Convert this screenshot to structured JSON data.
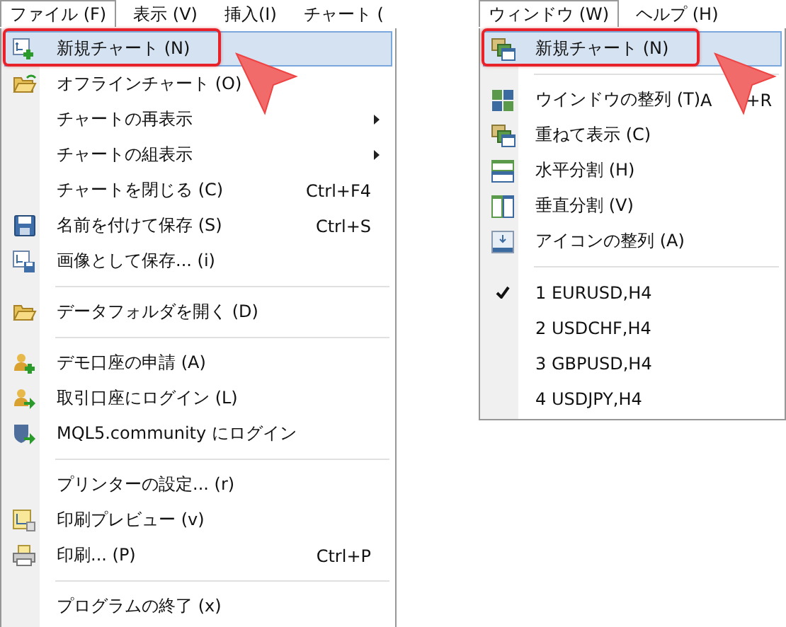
{
  "menus": [
    {
      "menubar": [
        {
          "label": "ファイル (F)",
          "selected": true
        },
        {
          "label": "表示 (V)",
          "selected": false
        },
        {
          "label": "挿入(I)",
          "selected": false
        },
        {
          "label": "チャート (",
          "selected": false
        }
      ],
      "items": [
        {
          "kind": "item",
          "label": "新規チャート (N)",
          "selected": true,
          "marked": true
        },
        {
          "kind": "item",
          "label": "オフラインチャート (O)",
          "selected": false,
          "marked": false
        },
        {
          "kind": "item",
          "label": "チャートの再表示",
          "selected": false,
          "marked": false,
          "submenu": true
        },
        {
          "kind": "item",
          "label": "チャートの組表示",
          "selected": false,
          "marked": false,
          "submenu": true
        },
        {
          "kind": "item",
          "label": "チャートを閉じる (C)",
          "shortcut": "Ctrl+F4",
          "selected": false,
          "marked": false
        },
        {
          "kind": "item",
          "label": "名前を付けて保存 (S)",
          "shortcut": "Ctrl+S",
          "selected": false,
          "marked": false
        },
        {
          "kind": "item",
          "label": "画像として保存... (i)",
          "selected": false,
          "marked": false
        },
        {
          "kind": "separator"
        },
        {
          "kind": "item",
          "label": "データフォルダを開く (D)",
          "selected": false,
          "marked": false
        },
        {
          "kind": "separator"
        },
        {
          "kind": "item",
          "label": "デモ口座の申請 (A)",
          "selected": false,
          "marked": false
        },
        {
          "kind": "item",
          "label": "取引口座にログイン (L)",
          "selected": false,
          "marked": false
        },
        {
          "kind": "item",
          "label": "MQL5.community にログイン",
          "selected": false,
          "marked": false
        },
        {
          "kind": "separator"
        },
        {
          "kind": "item",
          "label": "プリンターの設定... (r)",
          "selected": false,
          "marked": false
        },
        {
          "kind": "item",
          "label": "印刷プレビュー (v)",
          "selected": false,
          "marked": false
        },
        {
          "kind": "item",
          "label": "印刷... (P)",
          "shortcut": "Ctrl+P",
          "selected": false,
          "marked": false
        },
        {
          "kind": "separator"
        },
        {
          "kind": "item",
          "label": "プログラムの終了 (x)",
          "selected": false,
          "marked": false
        }
      ]
    },
    {
      "menubar": [
        {
          "label": "ウィンドウ (W)",
          "selected": true
        },
        {
          "label": "ヘルプ (H)",
          "selected": false
        }
      ],
      "items": [
        {
          "kind": "item",
          "label": "新規チャート (N)",
          "selected": true,
          "marked": true
        },
        {
          "kind": "separator"
        },
        {
          "kind": "item",
          "label": "ウインドウの整列 (T)",
          "shortcut": [
            "A",
            "+R"
          ],
          "selected": false,
          "marked": false
        },
        {
          "kind": "item",
          "label": "重ねて表示 (C)",
          "selected": false,
          "marked": false
        },
        {
          "kind": "item",
          "label": "水平分割 (H)",
          "selected": false,
          "marked": false
        },
        {
          "kind": "item",
          "label": "垂直分割 (V)",
          "selected": false,
          "marked": false
        },
        {
          "kind": "item",
          "label": "アイコンの整列 (A)",
          "selected": false,
          "marked": false
        },
        {
          "kind": "separator"
        },
        {
          "kind": "item",
          "label": "1 EURUSD,H4",
          "checked": true,
          "selected": false,
          "marked": false
        },
        {
          "kind": "item",
          "label": "2 USDCHF,H4",
          "checked": false,
          "selected": false,
          "marked": false
        },
        {
          "kind": "item",
          "label": "3 GBPUSD,H4",
          "checked": false,
          "selected": false,
          "marked": false
        },
        {
          "kind": "item",
          "label": "4 USDJPY,H4",
          "checked": false,
          "selected": false,
          "marked": false
        }
      ]
    }
  ]
}
